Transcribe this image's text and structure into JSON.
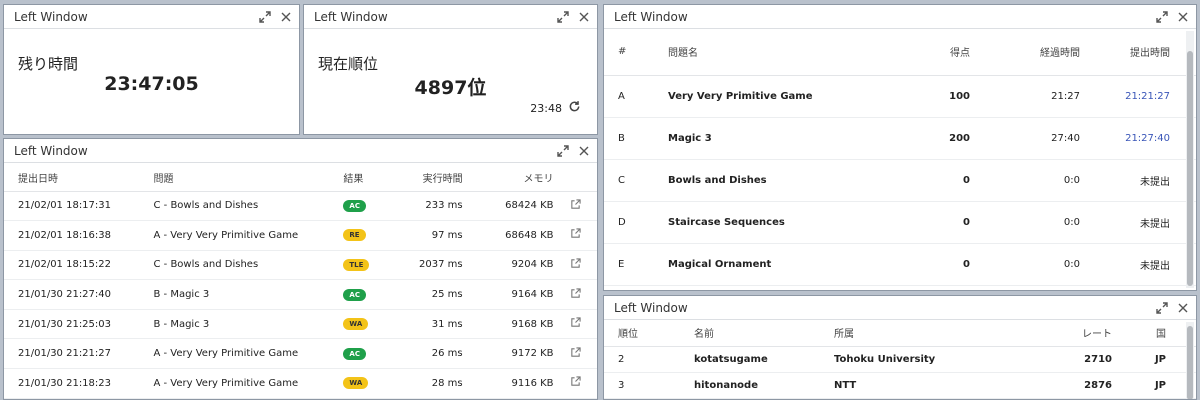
{
  "window_title": "Left Window",
  "remaining": {
    "label": "残り時間",
    "value": "23:47:05"
  },
  "rank": {
    "label": "現在順位",
    "value": "4897位",
    "updated": "23:48"
  },
  "submissions": {
    "headers": [
      "提出日時",
      "問題",
      "結果",
      "実行時間",
      "メモリ"
    ],
    "rows": [
      {
        "date": "21/02/01 18:17:31",
        "problem": "C - Bowls and Dishes",
        "result": "AC",
        "time": "233 ms",
        "memory": "68424 KB"
      },
      {
        "date": "21/02/01 18:16:38",
        "problem": "A - Very Very Primitive Game",
        "result": "RE",
        "time": "97 ms",
        "memory": "68648 KB"
      },
      {
        "date": "21/02/01 18:15:22",
        "problem": "C - Bowls and Dishes",
        "result": "TLE",
        "time": "2037 ms",
        "memory": "9204 KB"
      },
      {
        "date": "21/01/30 21:27:40",
        "problem": "B - Magic 3",
        "result": "AC",
        "time": "25 ms",
        "memory": "9164 KB"
      },
      {
        "date": "21/01/30 21:25:03",
        "problem": "B - Magic 3",
        "result": "WA",
        "time": "31 ms",
        "memory": "9168 KB"
      },
      {
        "date": "21/01/30 21:21:27",
        "problem": "A - Very Very Primitive Game",
        "result": "AC",
        "time": "26 ms",
        "memory": "9172 KB"
      },
      {
        "date": "21/01/30 21:18:23",
        "problem": "A - Very Very Primitive Game",
        "result": "WA",
        "time": "28 ms",
        "memory": "9116 KB"
      }
    ]
  },
  "problems": {
    "headers": [
      "#",
      "問題名",
      "得点",
      "経過時間",
      "提出時間"
    ],
    "rows": [
      {
        "id": "A",
        "name": "Very Very Primitive Game",
        "score": "100",
        "elapsed": "21:27",
        "submitted": "21:21:27"
      },
      {
        "id": "B",
        "name": "Magic 3",
        "score": "200",
        "elapsed": "27:40",
        "submitted": "21:27:40"
      },
      {
        "id": "C",
        "name": "Bowls and Dishes",
        "score": "0",
        "elapsed": "0:0",
        "submitted": "未提出"
      },
      {
        "id": "D",
        "name": "Staircase Sequences",
        "score": "0",
        "elapsed": "0:0",
        "submitted": "未提出"
      },
      {
        "id": "E",
        "name": "Magical Ornament",
        "score": "0",
        "elapsed": "0:0",
        "submitted": "未提出"
      }
    ]
  },
  "ranking": {
    "headers": [
      "順位",
      "名前",
      "所属",
      "レート",
      "国"
    ],
    "rows": [
      {
        "rank": "2",
        "name": "kotatsugame",
        "affiliation": "Tohoku University",
        "rate": "2710",
        "country": "JP"
      },
      {
        "rank": "3",
        "name": "hitonanode",
        "affiliation": "NTT",
        "rate": "2876",
        "country": "JP"
      }
    ]
  },
  "colors": {
    "ac": "#1fa04a",
    "warn": "#f3c318",
    "link": "#3a56b8"
  }
}
